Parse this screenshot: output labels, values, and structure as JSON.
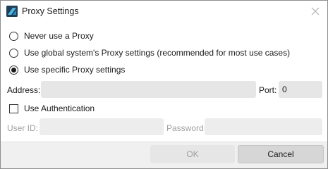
{
  "window": {
    "title": "Proxy Settings",
    "app_icon": "app-logo-icon",
    "close_icon": "close-icon"
  },
  "proxy_options": [
    {
      "label": "Never use a Proxy",
      "checked": false
    },
    {
      "label": "Use global system's Proxy settings (recommended for most use cases)",
      "checked": false
    },
    {
      "label": "Use specific Proxy settings",
      "checked": true
    }
  ],
  "address": {
    "label": "Address:",
    "value": ""
  },
  "port": {
    "label": "Port:",
    "value": "0"
  },
  "authentication": {
    "label": "Use Authentication",
    "checked": false
  },
  "user_id": {
    "label": "User ID:",
    "value": ""
  },
  "password": {
    "label": "Password:",
    "value": ""
  },
  "buttons": {
    "ok": "OK",
    "cancel": "Cancel"
  },
  "colors": {
    "app_icon_bg": "#1f3f57",
    "field_bg": "#e6e6e6",
    "disabled_text": "#a0a0a0",
    "footer_bg": "#f0f0f0"
  }
}
